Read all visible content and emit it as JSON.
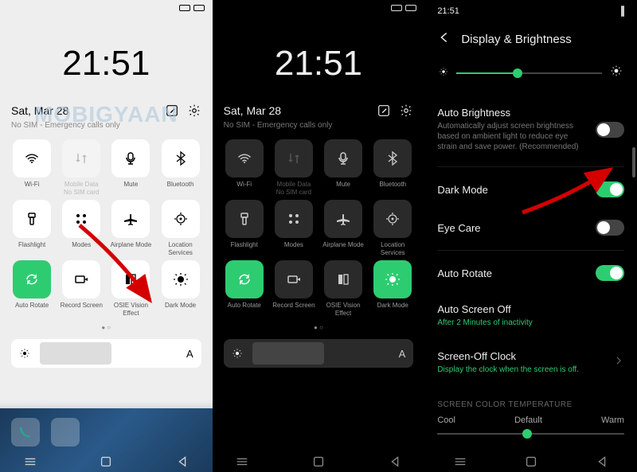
{
  "shared": {
    "time": "21:51",
    "date": "Sat, Mar 28",
    "sim_status": "No SIM - Emergency calls only",
    "brightness_auto_label": "A"
  },
  "qs_tiles": [
    {
      "id": "wifi",
      "label": "Wi-Fi"
    },
    {
      "id": "mobile-data",
      "label": "Mobile Data",
      "sublabel": "No SIM card",
      "disabled": true
    },
    {
      "id": "mute",
      "label": "Mute"
    },
    {
      "id": "bluetooth",
      "label": "Bluetooth"
    },
    {
      "id": "flashlight",
      "label": "Flashlight"
    },
    {
      "id": "modes",
      "label": "Modes"
    },
    {
      "id": "airplane",
      "label": "Airplane Mode"
    },
    {
      "id": "location",
      "label": "Location Services"
    },
    {
      "id": "auto-rotate",
      "label": "Auto Rotate"
    },
    {
      "id": "record",
      "label": "Record Screen"
    },
    {
      "id": "osie",
      "label": "OSIE Vision Effect"
    },
    {
      "id": "dark-mode",
      "label": "Dark Mode"
    }
  ],
  "panel1": {
    "watermark": "MOBIGYAAN",
    "active_tiles": [
      "auto-rotate"
    ]
  },
  "panel2": {
    "active_tiles": [
      "auto-rotate",
      "dark-mode"
    ]
  },
  "panel3": {
    "header": "Display & Brightness",
    "auto_bright": {
      "title": "Auto Brightness",
      "sub": "Automatically adjust screen brightness based on ambient light to reduce eye strain and save power. (Recommended)",
      "on": false
    },
    "dark_mode": {
      "title": "Dark Mode",
      "on": true
    },
    "eye_care": {
      "title": "Eye Care",
      "on": false
    },
    "auto_rotate": {
      "title": "Auto Rotate",
      "on": true
    },
    "auto_off": {
      "title": "Auto Screen Off",
      "sub": "After 2 Minutes of inactivity"
    },
    "clock": {
      "title": "Screen-Off Clock",
      "sub": "Display the clock when the screen is off."
    },
    "color_temp": {
      "header": "SCREEN COLOR TEMPERATURE",
      "cool": "Cool",
      "default": "Default",
      "warm": "Warm"
    }
  }
}
